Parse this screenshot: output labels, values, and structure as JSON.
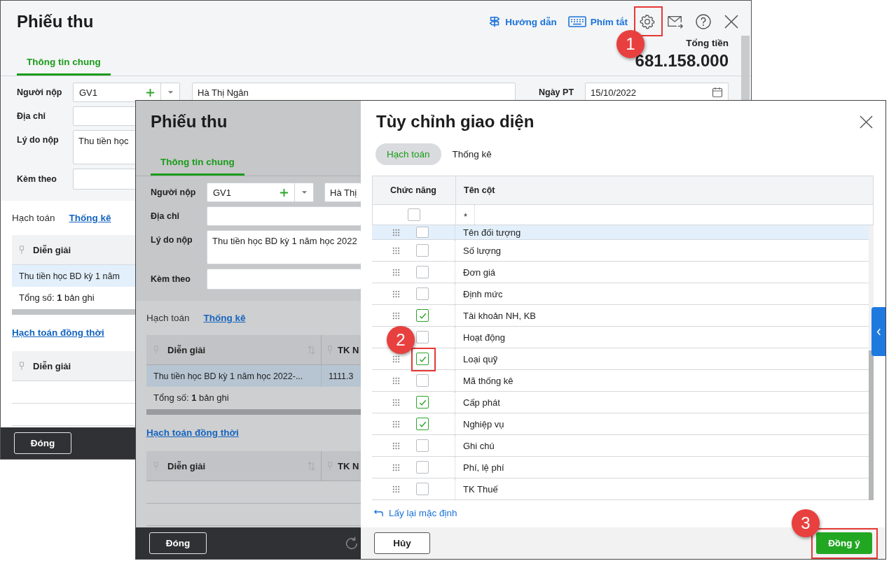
{
  "main_window": {
    "title": "Phiếu thu",
    "toolbar": [
      {
        "kind": "guide",
        "label": "Hướng dẫn"
      },
      {
        "kind": "keyboard",
        "label": "Phím tắt"
      }
    ],
    "total_label": "Tổng tiền",
    "total": "681.158.000",
    "tabs": [
      {
        "label": "Thông tin chung",
        "selected": true
      }
    ],
    "form": {
      "payer_label": "Người nộp",
      "payer_code": "GV1",
      "payer_name": "Hà Thị Ngân",
      "date_label": "Ngày PT",
      "date": "15/10/2022",
      "address_label": "Địa chỉ",
      "reason_label": "Lý do nộp",
      "reason": "Thu tiền học",
      "attach_label": "Kèm theo"
    },
    "section_tabs": [
      {
        "label": "Hạch toán",
        "selected": true
      },
      {
        "label": "Thống kê",
        "selected": false
      }
    ],
    "grid": {
      "columns": [
        "Diễn giải"
      ],
      "rows": [
        [
          "Thu tiền học BD kỳ 1 năm"
        ]
      ],
      "total": "Tổng số: **1** bản ghi"
    },
    "concurrent_link": "Hạch toán đồng thời",
    "grid2": {
      "columns": [
        "Diễn giải"
      ]
    },
    "close_button": "Đóng"
  },
  "front_window": {
    "title": "Phiếu thu",
    "tabs": [
      {
        "label": "Thông tin chung",
        "selected": true
      }
    ],
    "form": {
      "payer_label": "Người nộp",
      "payer_code": "GV1",
      "payer_name": "Hà Thị",
      "address_label": "Địa chỉ",
      "reason_label": "Lý do nộp",
      "reason": "Thu tiền học BD kỳ 1 năm học 2022",
      "attach_label": "Kèm theo"
    },
    "section_tabs": [
      {
        "label": "Hạch toán",
        "selected": true
      },
      {
        "label": "Thống kê",
        "selected": false
      }
    ],
    "grid": {
      "columns": [
        "Diễn giải",
        "TK N"
      ],
      "rows": [
        [
          "Thu tiền học BD kỳ 1 năm học 2022-...",
          "1111.3"
        ]
      ],
      "total": "Tổng số: **1** bản ghi"
    },
    "concurrent_link": "Hạch toán đồng thời",
    "grid2": {
      "columns": [
        "Diễn giải",
        "TK N"
      ]
    },
    "close_button": "Đóng"
  },
  "dialog": {
    "title": "Tùy chỉnh giao diện",
    "tabs": [
      {
        "label": "Hạch toán",
        "selected": true
      },
      {
        "label": "Thống kê",
        "selected": false
      }
    ],
    "columns": [
      "Chức năng",
      "Tên cột"
    ],
    "filter": {
      "checked": false,
      "value": "*"
    },
    "rows": [
      {
        "name": "Tên đối tượng",
        "checked": false,
        "selected": true
      },
      {
        "name": "Số lượng",
        "checked": false,
        "selected": false
      },
      {
        "name": "Đơn giá",
        "checked": false,
        "selected": false
      },
      {
        "name": "Định mức",
        "checked": false,
        "selected": false
      },
      {
        "name": "Tài khoản NH, KB",
        "checked": true,
        "selected": false
      },
      {
        "name": "Hoạt động",
        "checked": false,
        "selected": false
      },
      {
        "name": "Loại quỹ",
        "checked": true,
        "selected": false
      },
      {
        "name": "Mã thống kê",
        "checked": false,
        "selected": false
      },
      {
        "name": "Cấp phát",
        "checked": true,
        "selected": false
      },
      {
        "name": "Nghiệp vụ",
        "checked": true,
        "selected": false
      },
      {
        "name": "Ghi chú",
        "checked": false,
        "selected": false
      },
      {
        "name": "Phí, lệ phí",
        "checked": false,
        "selected": false
      },
      {
        "name": "TK Thuế",
        "checked": false,
        "selected": false
      }
    ],
    "reset_link": "Lấy lại mặc định",
    "cancel_button": "Hủy",
    "ok_button": "Đồng ý"
  },
  "callouts": [
    {
      "label": "1"
    },
    {
      "label": "2"
    },
    {
      "label": "3"
    }
  ]
}
